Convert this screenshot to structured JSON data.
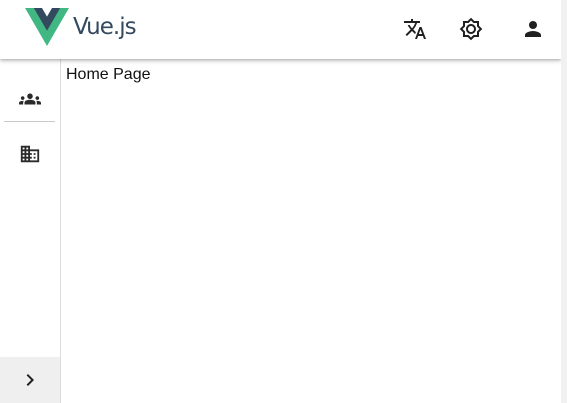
{
  "header": {
    "logo_text": "Vue.js",
    "logo_colors": {
      "outer": "#41b883",
      "inner": "#34495e"
    },
    "actions": [
      {
        "icon": "translate-icon"
      },
      {
        "icon": "brightness-icon"
      },
      {
        "icon": "account-icon"
      }
    ]
  },
  "sidebar": {
    "items": [
      {
        "icon": "people-icon"
      },
      {
        "icon": "domain-icon"
      }
    ],
    "expand_icon": "chevron-right-icon"
  },
  "main": {
    "text": "Home Page"
  }
}
